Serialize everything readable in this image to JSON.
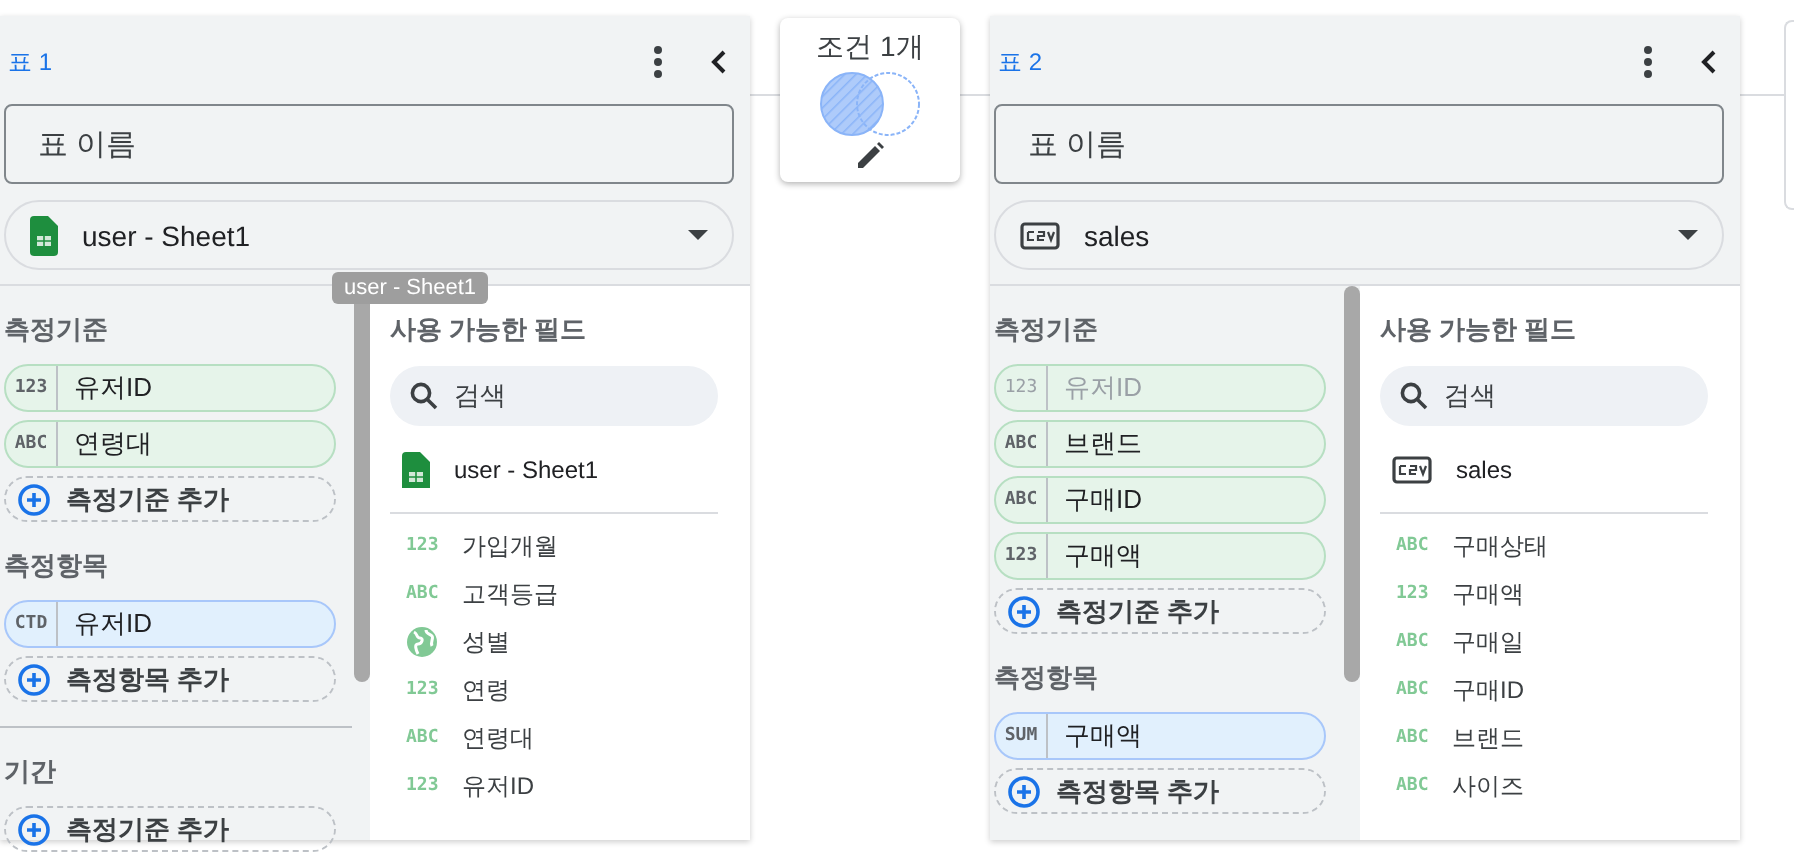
{
  "tables": [
    {
      "label": "표 1",
      "name_placeholder": "표 이름",
      "source": {
        "kind": "sheets",
        "name": "user - Sheet1"
      },
      "sections": [
        {
          "title": "측정기준",
          "kind": "dimension",
          "chips": [
            {
              "type": "123",
              "label": "유저ID",
              "disabled": false
            },
            {
              "type": "ABC",
              "label": "연령대",
              "disabled": false
            }
          ],
          "add_label": "측정기준 추가"
        },
        {
          "title": "측정항목",
          "kind": "metric",
          "chips": [
            {
              "type": "CTD",
              "label": "유저ID",
              "disabled": false
            }
          ],
          "add_label": "측정항목 추가"
        },
        {
          "title": "기간",
          "kind": "date",
          "add_label": "측정기준 추가"
        }
      ],
      "available": {
        "title": "사용 가능한 필드",
        "search_placeholder": "검색",
        "source": {
          "kind": "sheets",
          "name": "user - Sheet1"
        },
        "fields": [
          {
            "kind": "type",
            "type": "123",
            "label": "가입개월"
          },
          {
            "kind": "type",
            "type": "ABC",
            "label": "고객등급"
          },
          {
            "kind": "geo",
            "label": "성별"
          },
          {
            "kind": "type",
            "type": "123",
            "label": "연령"
          },
          {
            "kind": "type",
            "type": "ABC",
            "label": "연령대"
          },
          {
            "kind": "type",
            "type": "123",
            "label": "유저ID"
          }
        ]
      },
      "drag_label": "user - Sheet1"
    },
    {
      "label": "표 2",
      "name_placeholder": "표 이름",
      "source": {
        "kind": "csv",
        "name": "sales"
      },
      "sections": [
        {
          "title": "측정기준",
          "kind": "dimension",
          "chips": [
            {
              "type": "123",
              "label": "유저ID",
              "disabled": true
            },
            {
              "type": "ABC",
              "label": "브랜드",
              "disabled": false
            },
            {
              "type": "ABC",
              "label": "구매ID",
              "disabled": false
            },
            {
              "type": "123",
              "label": "구매액",
              "disabled": false
            }
          ],
          "add_label": "측정기준 추가"
        },
        {
          "title": "측정항목",
          "kind": "metric",
          "chips": [
            {
              "type": "SUM",
              "label": "구매액",
              "disabled": false
            }
          ],
          "add_label": "측정항목 추가"
        }
      ],
      "available": {
        "title": "사용 가능한 필드",
        "search_placeholder": "검색",
        "source": {
          "kind": "csv",
          "name": "sales"
        },
        "fields": [
          {
            "kind": "type",
            "type": "ABC",
            "label": "구매상태"
          },
          {
            "kind": "type",
            "type": "123",
            "label": "구매액"
          },
          {
            "kind": "type",
            "type": "ABC",
            "label": "구매일"
          },
          {
            "kind": "type",
            "type": "ABC",
            "label": "구매ID"
          },
          {
            "kind": "type",
            "type": "ABC",
            "label": "브랜드"
          },
          {
            "kind": "type",
            "type": "ABC",
            "label": "사이즈"
          }
        ]
      }
    }
  ],
  "join": {
    "label": "조건 1개"
  }
}
